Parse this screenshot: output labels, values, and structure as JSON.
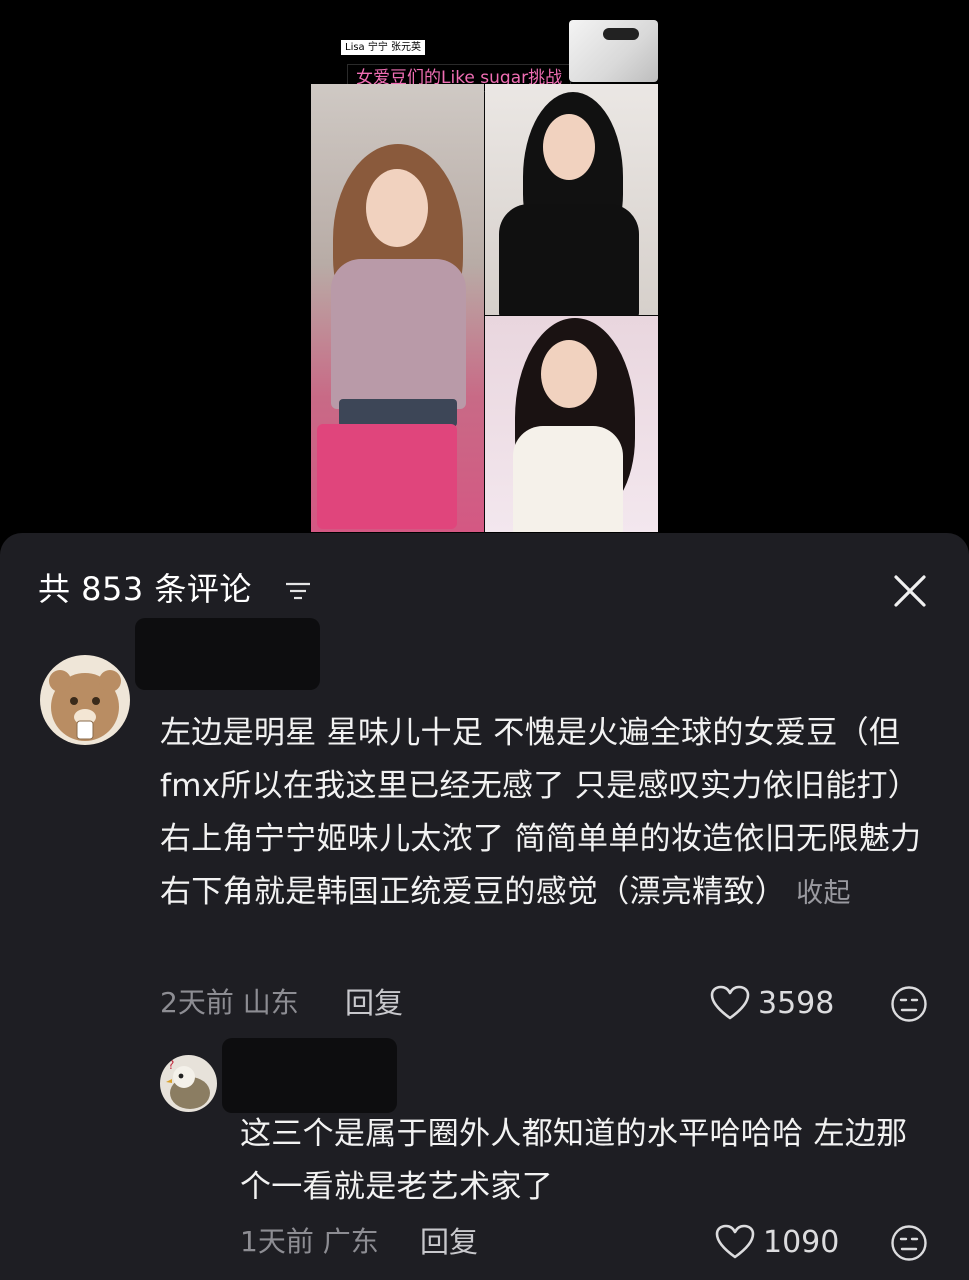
{
  "video": {
    "names_tag": "Lisa 宁宁 张元英",
    "caption": "女爱豆们的Like sugar挑战"
  },
  "comments_header": {
    "title": "共 853 条评论"
  },
  "comments": [
    {
      "text": "左边是明星 星味儿十足 不愧是火遍全球的女爱豆（但fmx所以在我这里已经无感了 只是感叹实力依旧能打）右上角宁宁姬味儿太浓了  简简单单的妆造依旧无限魅力   右下角就是韩国正统爱豆的感觉（漂亮精致）",
      "collapse_label": "收起",
      "time": "2天前",
      "location": "山东",
      "reply_label": "回复",
      "likes": "3598"
    },
    {
      "text": "这三个是属于圈外人都知道的水平哈哈哈 左边那个一看就是老艺术家了",
      "time": "1天前",
      "location": "广东",
      "reply_label": "回复",
      "likes": "1090"
    }
  ],
  "colors": {
    "sheet_bg": "#1e1e23",
    "caption_pink": "#f06eb4",
    "meta_gray": "#8d8d93"
  }
}
